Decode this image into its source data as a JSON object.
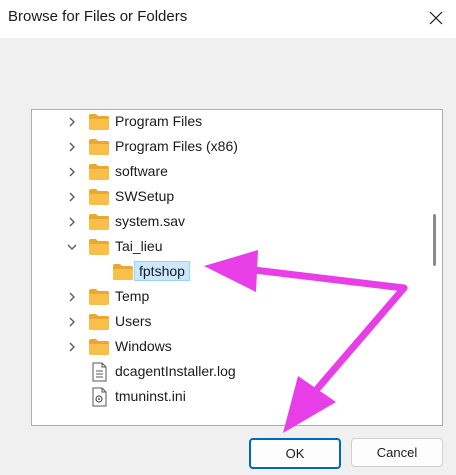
{
  "window": {
    "title": "Browse for Files or Folders",
    "close_icon": "close-icon"
  },
  "tree": {
    "items": [
      {
        "label": "Program Files",
        "icon": "folder-icon",
        "expand": "collapsed",
        "level": 0
      },
      {
        "label": "Program Files (x86)",
        "icon": "folder-icon",
        "expand": "collapsed",
        "level": 0
      },
      {
        "label": "software",
        "icon": "folder-icon",
        "expand": "collapsed",
        "level": 0
      },
      {
        "label": "SWSetup",
        "icon": "folder-icon",
        "expand": "collapsed",
        "level": 0
      },
      {
        "label": "system.sav",
        "icon": "folder-icon",
        "expand": "collapsed",
        "level": 0
      },
      {
        "label": "Tai_lieu",
        "icon": "folder-icon",
        "expand": "expanded",
        "level": 0
      },
      {
        "label": "fptshop",
        "icon": "folder-icon",
        "expand": "none",
        "level": 1,
        "selected": true
      },
      {
        "label": "Temp",
        "icon": "folder-icon",
        "expand": "collapsed",
        "level": 0
      },
      {
        "label": "Users",
        "icon": "folder-icon",
        "expand": "collapsed",
        "level": 0
      },
      {
        "label": "Windows",
        "icon": "folder-icon",
        "expand": "collapsed",
        "level": 0
      },
      {
        "label": "dcagentInstaller.log",
        "icon": "document-icon",
        "expand": "none",
        "level": 0
      },
      {
        "label": "tmuninst.ini",
        "icon": "settings-file-icon",
        "expand": "none",
        "level": 0
      }
    ]
  },
  "buttons": {
    "ok_label": "OK",
    "cancel_label": "Cancel"
  },
  "colors": {
    "folder": "#f8c04a",
    "selection": "#cce8ff",
    "accent": "#0067c0",
    "annotation_arrow": "#e83ee8"
  }
}
